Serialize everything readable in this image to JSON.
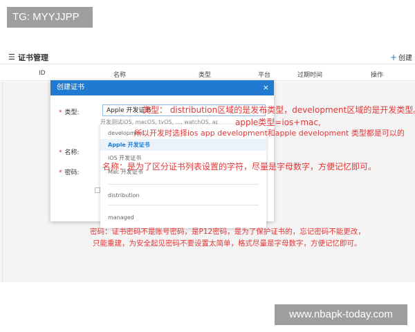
{
  "watermarks": {
    "top": "TG: MYYJJPP",
    "bottom": "www.nbapk-today.com"
  },
  "header": {
    "menu_icon": "menu-icon",
    "title": "证书管理",
    "create_plus": "+",
    "create_label": "创建"
  },
  "table": {
    "columns": [
      "ID",
      "名称",
      "类型",
      "平台",
      "过期时间",
      "操作"
    ]
  },
  "modal": {
    "title": "创建证书",
    "close_glyph": "×",
    "labels": {
      "type": "类型:",
      "name": "名称:",
      "password": "密码:"
    },
    "required_mark": "*",
    "type_value": "Apple 开发证书",
    "type_hint": "开发测试iOS, macOS, tvOS, ..., watchOS, apps使用",
    "dropdown": {
      "items": [
        "development",
        "Apple 开发证书",
        "iOS 开发证书",
        "Mac 开发证书",
        "distribution",
        "managed"
      ],
      "selected_index": 1
    }
  },
  "annotations": {
    "type_note": "类型：  distribution区域的是发布类型，development区域的是开发类型。",
    "apple_note": "apple类型=ios+mac,",
    "dev_note": "所以开发时选择ios app development和apple development 类型都是可以的",
    "name_note": "名称：是为了区分证书列表设置的字符，尽量是字母数字，方便记忆即可。",
    "password_note_1": "密码：证书密码不是账号密码，是P12密码，是为了保护证书的，忘记密码不能更改，",
    "password_note_2": "只能重建，为安全起见密码不要设置太简单，格式尽量是字母数字，方便记忆即可。"
  },
  "colors": {
    "modal_header": "#1f7ad0",
    "annotation": "#e53535",
    "watermark_bg": "#9e9e9e"
  }
}
